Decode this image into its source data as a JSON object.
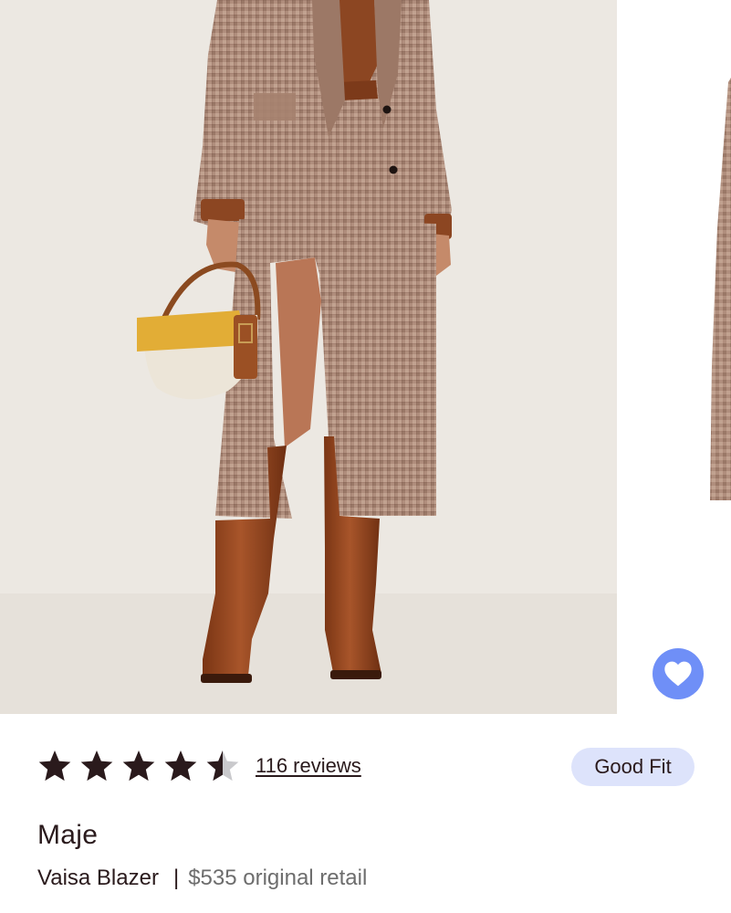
{
  "product": {
    "rating": {
      "value": 4.5,
      "max": 5,
      "reviews_label": "116 reviews"
    },
    "fit_badge": "Good Fit",
    "brand": "Maje",
    "name": "Vaisa Blazer",
    "divider": "|",
    "price_text": "$535 original retail"
  },
  "carousel": {
    "favorite_icon": "heart-icon"
  },
  "colors": {
    "accent": "#6f8ff7",
    "star": "#2a1a1c",
    "badge_bg": "#dde3fb",
    "text": "#2a1a1c",
    "muted_text": "#6d6d6d"
  }
}
